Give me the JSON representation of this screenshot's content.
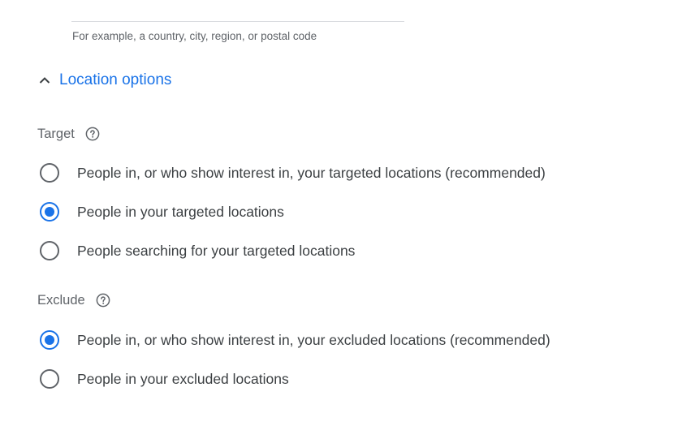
{
  "location_hint": "For example, a country, city, region, or postal code",
  "options_toggle": {
    "label": "Location options",
    "icon": "chevron-up-icon",
    "expanded": true
  },
  "target": {
    "title": "Target",
    "help_icon": "help-circle-icon",
    "options": [
      {
        "label": "People in, or who show interest in, your targeted locations (recommended)",
        "selected": false
      },
      {
        "label": "People in your targeted locations",
        "selected": true
      },
      {
        "label": "People searching for your targeted locations",
        "selected": false
      }
    ]
  },
  "exclude": {
    "title": "Exclude",
    "help_icon": "help-circle-icon",
    "options": [
      {
        "label": "People in, or who show interest in, your excluded locations (recommended)",
        "selected": true
      },
      {
        "label": "People in your excluded locations",
        "selected": false
      }
    ]
  },
  "colors": {
    "accent": "#1a73e8",
    "radio_unselected": "#5f6368",
    "text": "#3c4043",
    "muted_text": "#5f6368",
    "divider": "#dadce0"
  }
}
